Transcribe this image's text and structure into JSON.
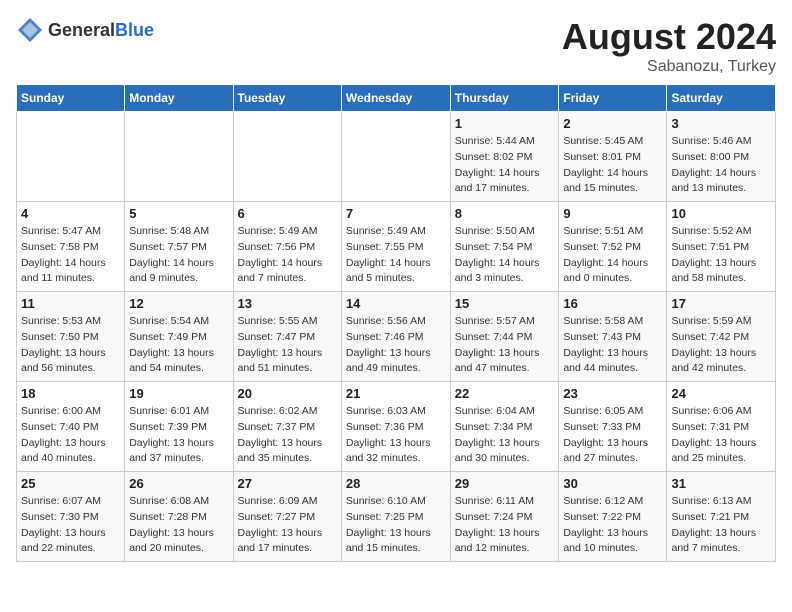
{
  "header": {
    "logo_general": "General",
    "logo_blue": "Blue",
    "month_year": "August 2024",
    "location": "Sabanozu, Turkey"
  },
  "days_of_week": [
    "Sunday",
    "Monday",
    "Tuesday",
    "Wednesday",
    "Thursday",
    "Friday",
    "Saturday"
  ],
  "weeks": [
    [
      {
        "day": "",
        "sunrise": "",
        "sunset": "",
        "daylight": ""
      },
      {
        "day": "",
        "sunrise": "",
        "sunset": "",
        "daylight": ""
      },
      {
        "day": "",
        "sunrise": "",
        "sunset": "",
        "daylight": ""
      },
      {
        "day": "",
        "sunrise": "",
        "sunset": "",
        "daylight": ""
      },
      {
        "day": "1",
        "sunrise": "Sunrise: 5:44 AM",
        "sunset": "Sunset: 8:02 PM",
        "daylight": "Daylight: 14 hours and 17 minutes."
      },
      {
        "day": "2",
        "sunrise": "Sunrise: 5:45 AM",
        "sunset": "Sunset: 8:01 PM",
        "daylight": "Daylight: 14 hours and 15 minutes."
      },
      {
        "day": "3",
        "sunrise": "Sunrise: 5:46 AM",
        "sunset": "Sunset: 8:00 PM",
        "daylight": "Daylight: 14 hours and 13 minutes."
      }
    ],
    [
      {
        "day": "4",
        "sunrise": "Sunrise: 5:47 AM",
        "sunset": "Sunset: 7:58 PM",
        "daylight": "Daylight: 14 hours and 11 minutes."
      },
      {
        "day": "5",
        "sunrise": "Sunrise: 5:48 AM",
        "sunset": "Sunset: 7:57 PM",
        "daylight": "Daylight: 14 hours and 9 minutes."
      },
      {
        "day": "6",
        "sunrise": "Sunrise: 5:49 AM",
        "sunset": "Sunset: 7:56 PM",
        "daylight": "Daylight: 14 hours and 7 minutes."
      },
      {
        "day": "7",
        "sunrise": "Sunrise: 5:49 AM",
        "sunset": "Sunset: 7:55 PM",
        "daylight": "Daylight: 14 hours and 5 minutes."
      },
      {
        "day": "8",
        "sunrise": "Sunrise: 5:50 AM",
        "sunset": "Sunset: 7:54 PM",
        "daylight": "Daylight: 14 hours and 3 minutes."
      },
      {
        "day": "9",
        "sunrise": "Sunrise: 5:51 AM",
        "sunset": "Sunset: 7:52 PM",
        "daylight": "Daylight: 14 hours and 0 minutes."
      },
      {
        "day": "10",
        "sunrise": "Sunrise: 5:52 AM",
        "sunset": "Sunset: 7:51 PM",
        "daylight": "Daylight: 13 hours and 58 minutes."
      }
    ],
    [
      {
        "day": "11",
        "sunrise": "Sunrise: 5:53 AM",
        "sunset": "Sunset: 7:50 PM",
        "daylight": "Daylight: 13 hours and 56 minutes."
      },
      {
        "day": "12",
        "sunrise": "Sunrise: 5:54 AM",
        "sunset": "Sunset: 7:49 PM",
        "daylight": "Daylight: 13 hours and 54 minutes."
      },
      {
        "day": "13",
        "sunrise": "Sunrise: 5:55 AM",
        "sunset": "Sunset: 7:47 PM",
        "daylight": "Daylight: 13 hours and 51 minutes."
      },
      {
        "day": "14",
        "sunrise": "Sunrise: 5:56 AM",
        "sunset": "Sunset: 7:46 PM",
        "daylight": "Daylight: 13 hours and 49 minutes."
      },
      {
        "day": "15",
        "sunrise": "Sunrise: 5:57 AM",
        "sunset": "Sunset: 7:44 PM",
        "daylight": "Daylight: 13 hours and 47 minutes."
      },
      {
        "day": "16",
        "sunrise": "Sunrise: 5:58 AM",
        "sunset": "Sunset: 7:43 PM",
        "daylight": "Daylight: 13 hours and 44 minutes."
      },
      {
        "day": "17",
        "sunrise": "Sunrise: 5:59 AM",
        "sunset": "Sunset: 7:42 PM",
        "daylight": "Daylight: 13 hours and 42 minutes."
      }
    ],
    [
      {
        "day": "18",
        "sunrise": "Sunrise: 6:00 AM",
        "sunset": "Sunset: 7:40 PM",
        "daylight": "Daylight: 13 hours and 40 minutes."
      },
      {
        "day": "19",
        "sunrise": "Sunrise: 6:01 AM",
        "sunset": "Sunset: 7:39 PM",
        "daylight": "Daylight: 13 hours and 37 minutes."
      },
      {
        "day": "20",
        "sunrise": "Sunrise: 6:02 AM",
        "sunset": "Sunset: 7:37 PM",
        "daylight": "Daylight: 13 hours and 35 minutes."
      },
      {
        "day": "21",
        "sunrise": "Sunrise: 6:03 AM",
        "sunset": "Sunset: 7:36 PM",
        "daylight": "Daylight: 13 hours and 32 minutes."
      },
      {
        "day": "22",
        "sunrise": "Sunrise: 6:04 AM",
        "sunset": "Sunset: 7:34 PM",
        "daylight": "Daylight: 13 hours and 30 minutes."
      },
      {
        "day": "23",
        "sunrise": "Sunrise: 6:05 AM",
        "sunset": "Sunset: 7:33 PM",
        "daylight": "Daylight: 13 hours and 27 minutes."
      },
      {
        "day": "24",
        "sunrise": "Sunrise: 6:06 AM",
        "sunset": "Sunset: 7:31 PM",
        "daylight": "Daylight: 13 hours and 25 minutes."
      }
    ],
    [
      {
        "day": "25",
        "sunrise": "Sunrise: 6:07 AM",
        "sunset": "Sunset: 7:30 PM",
        "daylight": "Daylight: 13 hours and 22 minutes."
      },
      {
        "day": "26",
        "sunrise": "Sunrise: 6:08 AM",
        "sunset": "Sunset: 7:28 PM",
        "daylight": "Daylight: 13 hours and 20 minutes."
      },
      {
        "day": "27",
        "sunrise": "Sunrise: 6:09 AM",
        "sunset": "Sunset: 7:27 PM",
        "daylight": "Daylight: 13 hours and 17 minutes."
      },
      {
        "day": "28",
        "sunrise": "Sunrise: 6:10 AM",
        "sunset": "Sunset: 7:25 PM",
        "daylight": "Daylight: 13 hours and 15 minutes."
      },
      {
        "day": "29",
        "sunrise": "Sunrise: 6:11 AM",
        "sunset": "Sunset: 7:24 PM",
        "daylight": "Daylight: 13 hours and 12 minutes."
      },
      {
        "day": "30",
        "sunrise": "Sunrise: 6:12 AM",
        "sunset": "Sunset: 7:22 PM",
        "daylight": "Daylight: 13 hours and 10 minutes."
      },
      {
        "day": "31",
        "sunrise": "Sunrise: 6:13 AM",
        "sunset": "Sunset: 7:21 PM",
        "daylight": "Daylight: 13 hours and 7 minutes."
      }
    ]
  ]
}
